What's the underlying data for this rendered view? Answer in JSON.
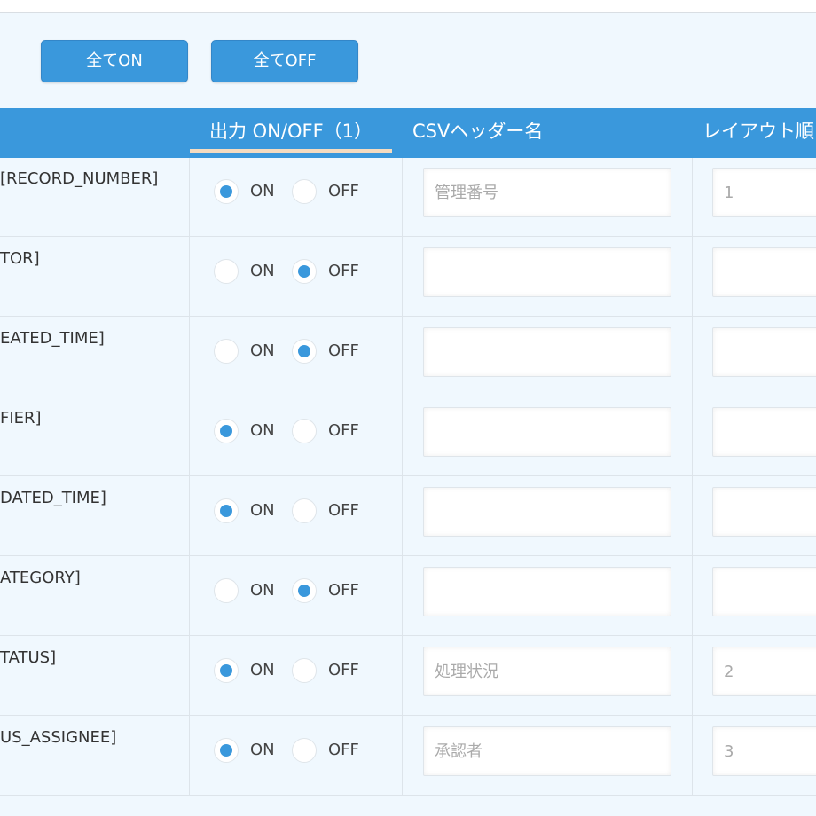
{
  "buttons": {
    "all_on": "全てON",
    "all_off": "全てOFF"
  },
  "header": {
    "output": "出力 ON/OFF（1）",
    "csv_header_name": "CSVヘッダー名",
    "layout_order": "レイアウト順"
  },
  "radio_labels": {
    "on": "ON",
    "off": "OFF"
  },
  "rows": [
    {
      "field": "[RECORD_NUMBER]",
      "output": "on",
      "csv": "管理番号",
      "layout": "1"
    },
    {
      "field": "TOR]",
      "output": "off",
      "csv": "",
      "layout": ""
    },
    {
      "field": "EATED_TIME]",
      "output": "off",
      "csv": "",
      "layout": ""
    },
    {
      "field": "FIER]",
      "output": "on",
      "csv": "",
      "layout": ""
    },
    {
      "field": "DATED_TIME]",
      "output": "on",
      "csv": "",
      "layout": ""
    },
    {
      "field": "ATEGORY]",
      "output": "off",
      "csv": "",
      "layout": ""
    },
    {
      "field": "TATUS]",
      "output": "on",
      "csv": "処理状況",
      "layout": "2"
    },
    {
      "field": "US_ASSIGNEE]",
      "output": "on",
      "csv": "承認者",
      "layout": "3"
    }
  ],
  "colors": {
    "accent": "#3a98dc",
    "background": "#f0f8fe",
    "underline": "#f6dcc0"
  }
}
